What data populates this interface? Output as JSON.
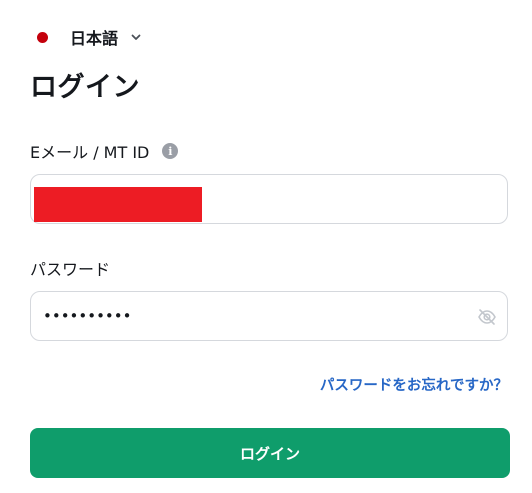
{
  "language": {
    "label": "日本語",
    "flag_color": "#c4000c",
    "dropdown_icon": "chevron-down-icon"
  },
  "title": "ログイン",
  "email": {
    "label": "Eメール / MT ID",
    "info_icon_glyph": "i",
    "value_redacted": true,
    "redaction_color": "#ed1c24"
  },
  "password": {
    "label": "パスワード",
    "value": "••••••••••",
    "toggle_icon": "eye-off-icon"
  },
  "forgot_link": "パスワードをお忘れですか？",
  "login_button": "ログイン",
  "colors": {
    "primary": "#0f9d6b",
    "link": "#2767c6",
    "text": "#15181d",
    "border": "#d5d8dd",
    "muted_icon": "#9a9ea6"
  }
}
